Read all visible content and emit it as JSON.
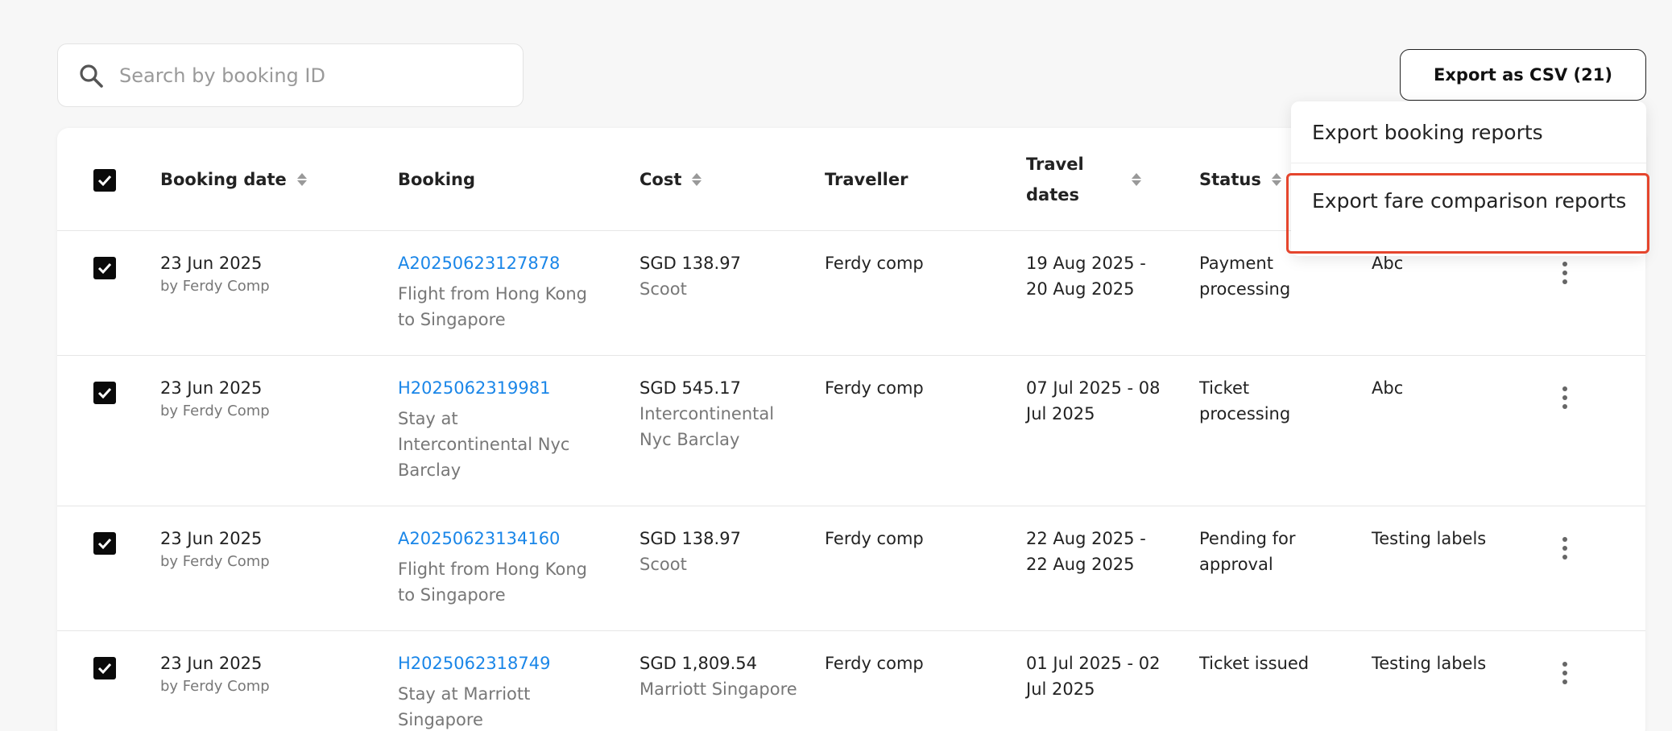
{
  "search": {
    "placeholder": "Search by booking ID",
    "value": ""
  },
  "export_button": {
    "label": "Export as CSV (21)"
  },
  "export_menu": {
    "items": [
      {
        "label": "Export booking reports"
      },
      {
        "label": "Export fare comparison reports"
      }
    ]
  },
  "table": {
    "headers": {
      "booking_date": "Booking date",
      "booking": "Booking",
      "cost": "Cost",
      "traveller": "Traveller",
      "travel_dates": "Travel dates",
      "status": "Status"
    },
    "rows": [
      {
        "date": "23 Jun 2025",
        "by": "by Ferdy Comp",
        "booking_id": "A20250623127878",
        "booking_desc": "Flight from Hong Kong to Singapore",
        "cost": "SGD 138.97",
        "vendor": "Scoot",
        "traveller": "Ferdy comp",
        "travel_dates": "19 Aug 2025 - 20 Aug 2025",
        "status": "Payment processing",
        "label": "Abc"
      },
      {
        "date": "23 Jun 2025",
        "by": "by Ferdy Comp",
        "booking_id": "H2025062319981",
        "booking_desc": "Stay at Intercontinental Nyc Barclay",
        "cost": "SGD 545.17",
        "vendor": "Intercontinental Nyc Barclay",
        "traveller": "Ferdy comp",
        "travel_dates": "07 Jul 2025 - 08 Jul 2025",
        "status": "Ticket processing",
        "label": "Abc"
      },
      {
        "date": "23 Jun 2025",
        "by": "by Ferdy Comp",
        "booking_id": "A20250623134160",
        "booking_desc": "Flight from Hong Kong to Singapore",
        "cost": "SGD 138.97",
        "vendor": "Scoot",
        "traveller": "Ferdy comp",
        "travel_dates": "22 Aug 2025 - 22 Aug 2025",
        "status": "Pending for approval",
        "label": "Testing labels"
      },
      {
        "date": "23 Jun 2025",
        "by": "by Ferdy Comp",
        "booking_id": "H2025062318749",
        "booking_desc": "Stay at Marriott Singapore",
        "cost": "SGD 1,809.54",
        "vendor": "Marriott Singapore",
        "traveller": "Ferdy comp",
        "travel_dates": "01 Jul 2025 - 02 Jul 2025",
        "status": "Ticket issued",
        "label": "Testing labels"
      }
    ]
  },
  "colors": {
    "link": "#1a86e8",
    "highlight": "#e5452d",
    "checkbox": "#0a0a0a"
  }
}
